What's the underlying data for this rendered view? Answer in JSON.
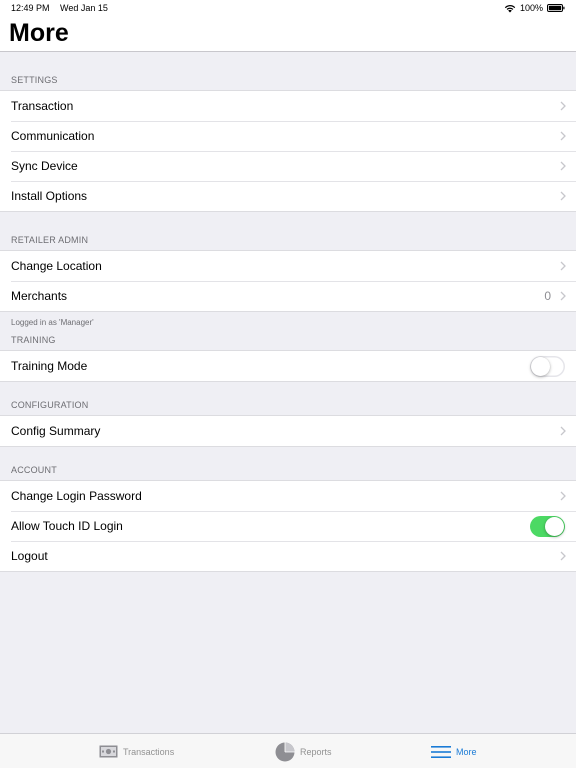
{
  "status_bar": {
    "time": "12:49 PM",
    "date": "Wed Jan 15",
    "battery": "100%"
  },
  "header": {
    "title": "More"
  },
  "sections": {
    "settings": {
      "title": "SETTINGS",
      "items": [
        "Transaction",
        "Communication",
        "Sync Device",
        "Install Options"
      ]
    },
    "retailer_admin": {
      "title": "RETAILER ADMIN",
      "change_location": "Change Location",
      "merchants": "Merchants",
      "merchants_count": "0",
      "footer": "Logged in as 'Manager'"
    },
    "training": {
      "title": "TRAINING",
      "training_mode": "Training Mode",
      "training_mode_on": false
    },
    "configuration": {
      "title": "CONFIGURATION",
      "config_summary": "Config Summary"
    },
    "account": {
      "title": "ACCOUNT",
      "change_password": "Change Login Password",
      "touch_id": "Allow Touch ID Login",
      "touch_id_on": true,
      "logout": "Logout"
    }
  },
  "tab_bar": {
    "tabs": [
      {
        "label": "Transactions",
        "icon": "cash-icon",
        "active": false
      },
      {
        "label": "Reports",
        "icon": "pie-chart-icon",
        "active": false
      },
      {
        "label": "More",
        "icon": "menu-icon",
        "active": true
      }
    ]
  },
  "colors": {
    "accent": "#1a7bd6",
    "toggle_on": "#4cd964",
    "background": "#efeff4"
  }
}
